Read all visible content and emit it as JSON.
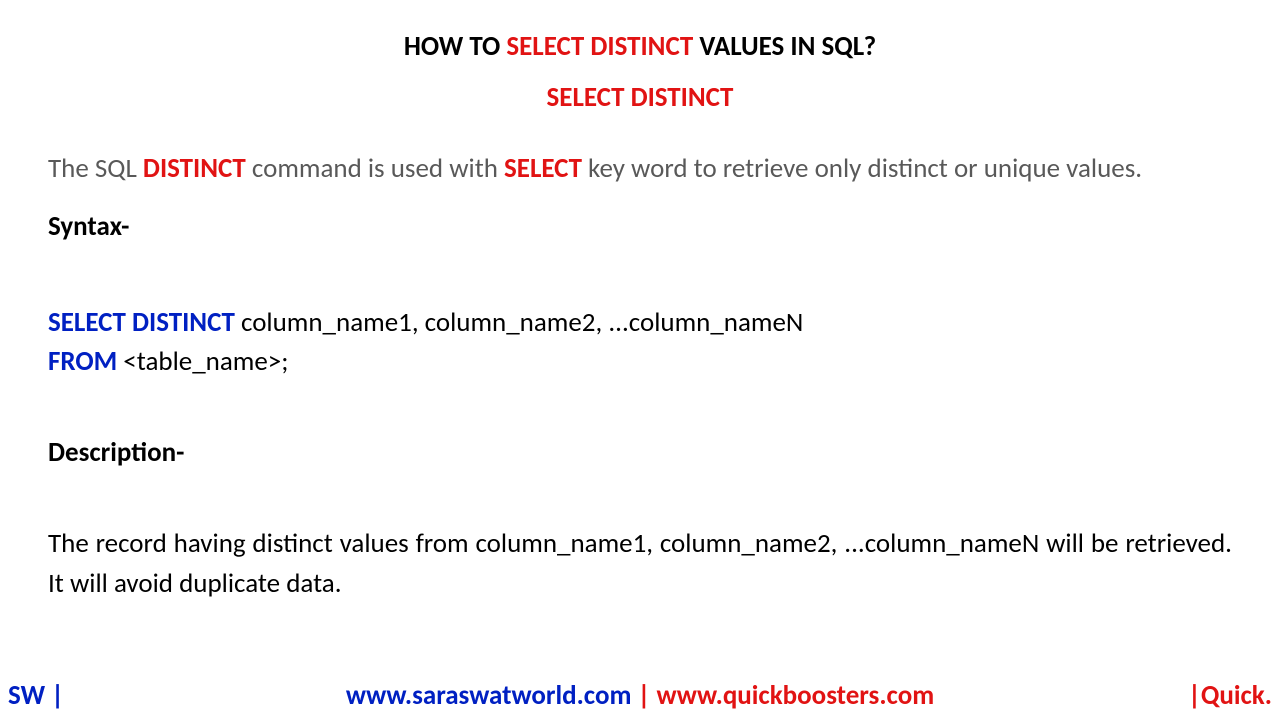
{
  "title": {
    "part1": "HOW TO ",
    "highlight": "SELECT DISTINCT",
    "part2": " VALUES IN SQL?"
  },
  "subtitle": "SELECT DISTINCT",
  "intro": {
    "p1": "The SQL ",
    "kw1": "DISTINCT",
    "p2": " command is used with ",
    "kw2": "SELECT",
    "p3": " key word to retrieve only distinct or unique values."
  },
  "syntax_label": "Syntax-",
  "code": {
    "kw1": "SELECT DISTINCT",
    "line1_rest": " column_name1, column_name2, ...column_nameN",
    "kw2": "FROM",
    "line2_rest": " <table_name>;"
  },
  "description_label": "Description-",
  "description_text": "The record having distinct values from column_name1, column_name2, ...column_nameN will be retrieved. It will avoid duplicate data.",
  "footer": {
    "left": "SW |",
    "url1": "www.saraswatworld.com",
    "sep": " | ",
    "url2": "www.quickboosters.com",
    "right": "|Quick."
  }
}
